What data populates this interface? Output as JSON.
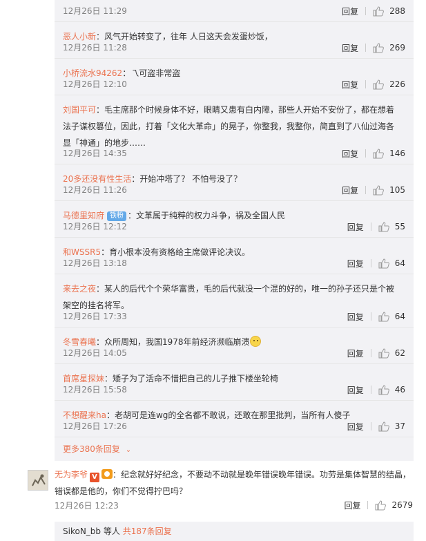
{
  "replies": [
    {
      "user": "",
      "text": "",
      "time": "12月26日 11:29",
      "reply_label": "回复",
      "likes": "288"
    },
    {
      "user": "恶人小新",
      "text": "：风气开始转变了，往年 人日这天会发蛋炒饭，",
      "time": "12月26日 11:28",
      "reply_label": "回复",
      "likes": "269"
    },
    {
      "user": "小桥流水94262",
      "text": "：乁可盗非常盗",
      "time": "12月26日 12:10",
      "reply_label": "回复",
      "likes": "226"
    },
    {
      "user": "刘国平可",
      "text": "：毛主席那个时候身体不好，眼睛又患有白内障，那些人开始不安份了，都在想着法子谋权篡位，因此，打着「文化大革命」的晃子，你整我，我整你，简直到了八仙过海各显「神通」的地步……",
      "time": "12月26日 14:35",
      "reply_label": "回复",
      "likes": "146"
    },
    {
      "user": "20多还没有性生活",
      "text": "：开始冲塔了？ 不怕号没了？",
      "time": "12月26日 11:26",
      "reply_label": "回复",
      "likes": "105"
    },
    {
      "user": "马德里知府",
      "badge": "铁粉",
      "text": "：文革属于纯粹的权力斗争，祸及全国人民",
      "time": "12月26日 12:12",
      "reply_label": "回复",
      "likes": "55"
    },
    {
      "user": "和WSSR5",
      "text": "：育小根本没有资格给主席做评论决议。",
      "time": "12月26日 13:18",
      "reply_label": "回复",
      "likes": "64"
    },
    {
      "user": "来去之夜",
      "text": "：某人的后代个个荣华富贵，毛的后代就没一个混的好的，唯一的孙子还只是个被架空的挂名将军。",
      "time": "12月26日 17:33",
      "reply_label": "回复",
      "likes": "64"
    },
    {
      "user": "冬雪春曦",
      "text": "：众所周知，我国1978年前经济濒临崩溃",
      "emoji": "smile-emoji",
      "time": "12月26日 14:05",
      "reply_label": "回复",
      "likes": "62"
    },
    {
      "user": "首席星探妹",
      "text": "：矮子为了活命不惜把自己的儿子推下楼坐轮椅",
      "time": "12月26日 15:58",
      "reply_label": "回复",
      "likes": "46"
    },
    {
      "user": "不想醒来ha",
      "text": "：老胡可是连wg的全名都不敢说，还敢在那里批判，当所有人傻子",
      "time": "12月26日 17:26",
      "reply_label": "回复",
      "likes": "37"
    }
  ],
  "more_replies": "更多380条回复",
  "more_icon": "chevron-down-icon",
  "main_comment": {
    "user": "无为李爷",
    "v_badge": "V",
    "text": "：纪念就好好纪念，不要动不动就是晚年错误晚年错误。功劳是集体智慧的结晶，错误都是他的，你们不觉得拧巴吗？",
    "time": "12月26日 12:23",
    "reply_label": "回复",
    "likes": "2679"
  },
  "bottom": {
    "user": "SikoN_bb",
    "mid": " 等人",
    "link": "共187条回复"
  },
  "colors": {
    "accent": "#eb7350",
    "panel": "#f2f2f5",
    "muted": "#808080"
  }
}
